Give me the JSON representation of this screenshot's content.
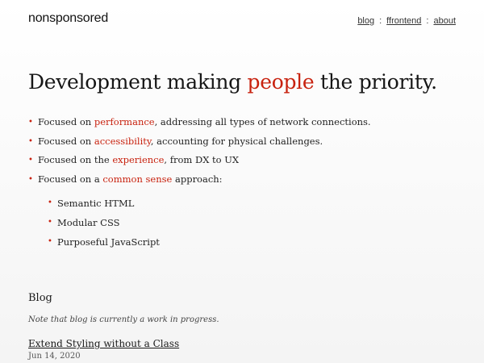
{
  "header": {
    "brand": "nonsponsored",
    "nav": [
      {
        "label": "blog"
      },
      {
        "label": "ffrontend"
      },
      {
        "label": "about"
      }
    ],
    "separator": ":"
  },
  "hero": {
    "before": "Development making ",
    "accent": "people",
    "after": " the priority."
  },
  "features": [
    {
      "before": "Focused on ",
      "accent": "performance",
      "after": ", addressing all types of network connections."
    },
    {
      "before": "Focused on ",
      "accent": "accessibility",
      "after": ", accounting for physical challenges."
    },
    {
      "before": "Focused on the ",
      "accent": "experience",
      "after": ", from DX to UX"
    },
    {
      "before": "Focused on a ",
      "accent": "common sense",
      "after": " approach:"
    }
  ],
  "approach": [
    {
      "label": "Semantic HTML"
    },
    {
      "label": "Modular CSS"
    },
    {
      "label": "Purposeful JavaScript"
    }
  ],
  "blog": {
    "title": "Blog",
    "note": "Note that blog is currently a work in progress.",
    "posts": [
      {
        "title": "Extend Styling without a Class",
        "date": "Jun 14, 2020"
      }
    ]
  },
  "colors": {
    "accent": "#c8220f",
    "text": "#1f1f1f"
  }
}
